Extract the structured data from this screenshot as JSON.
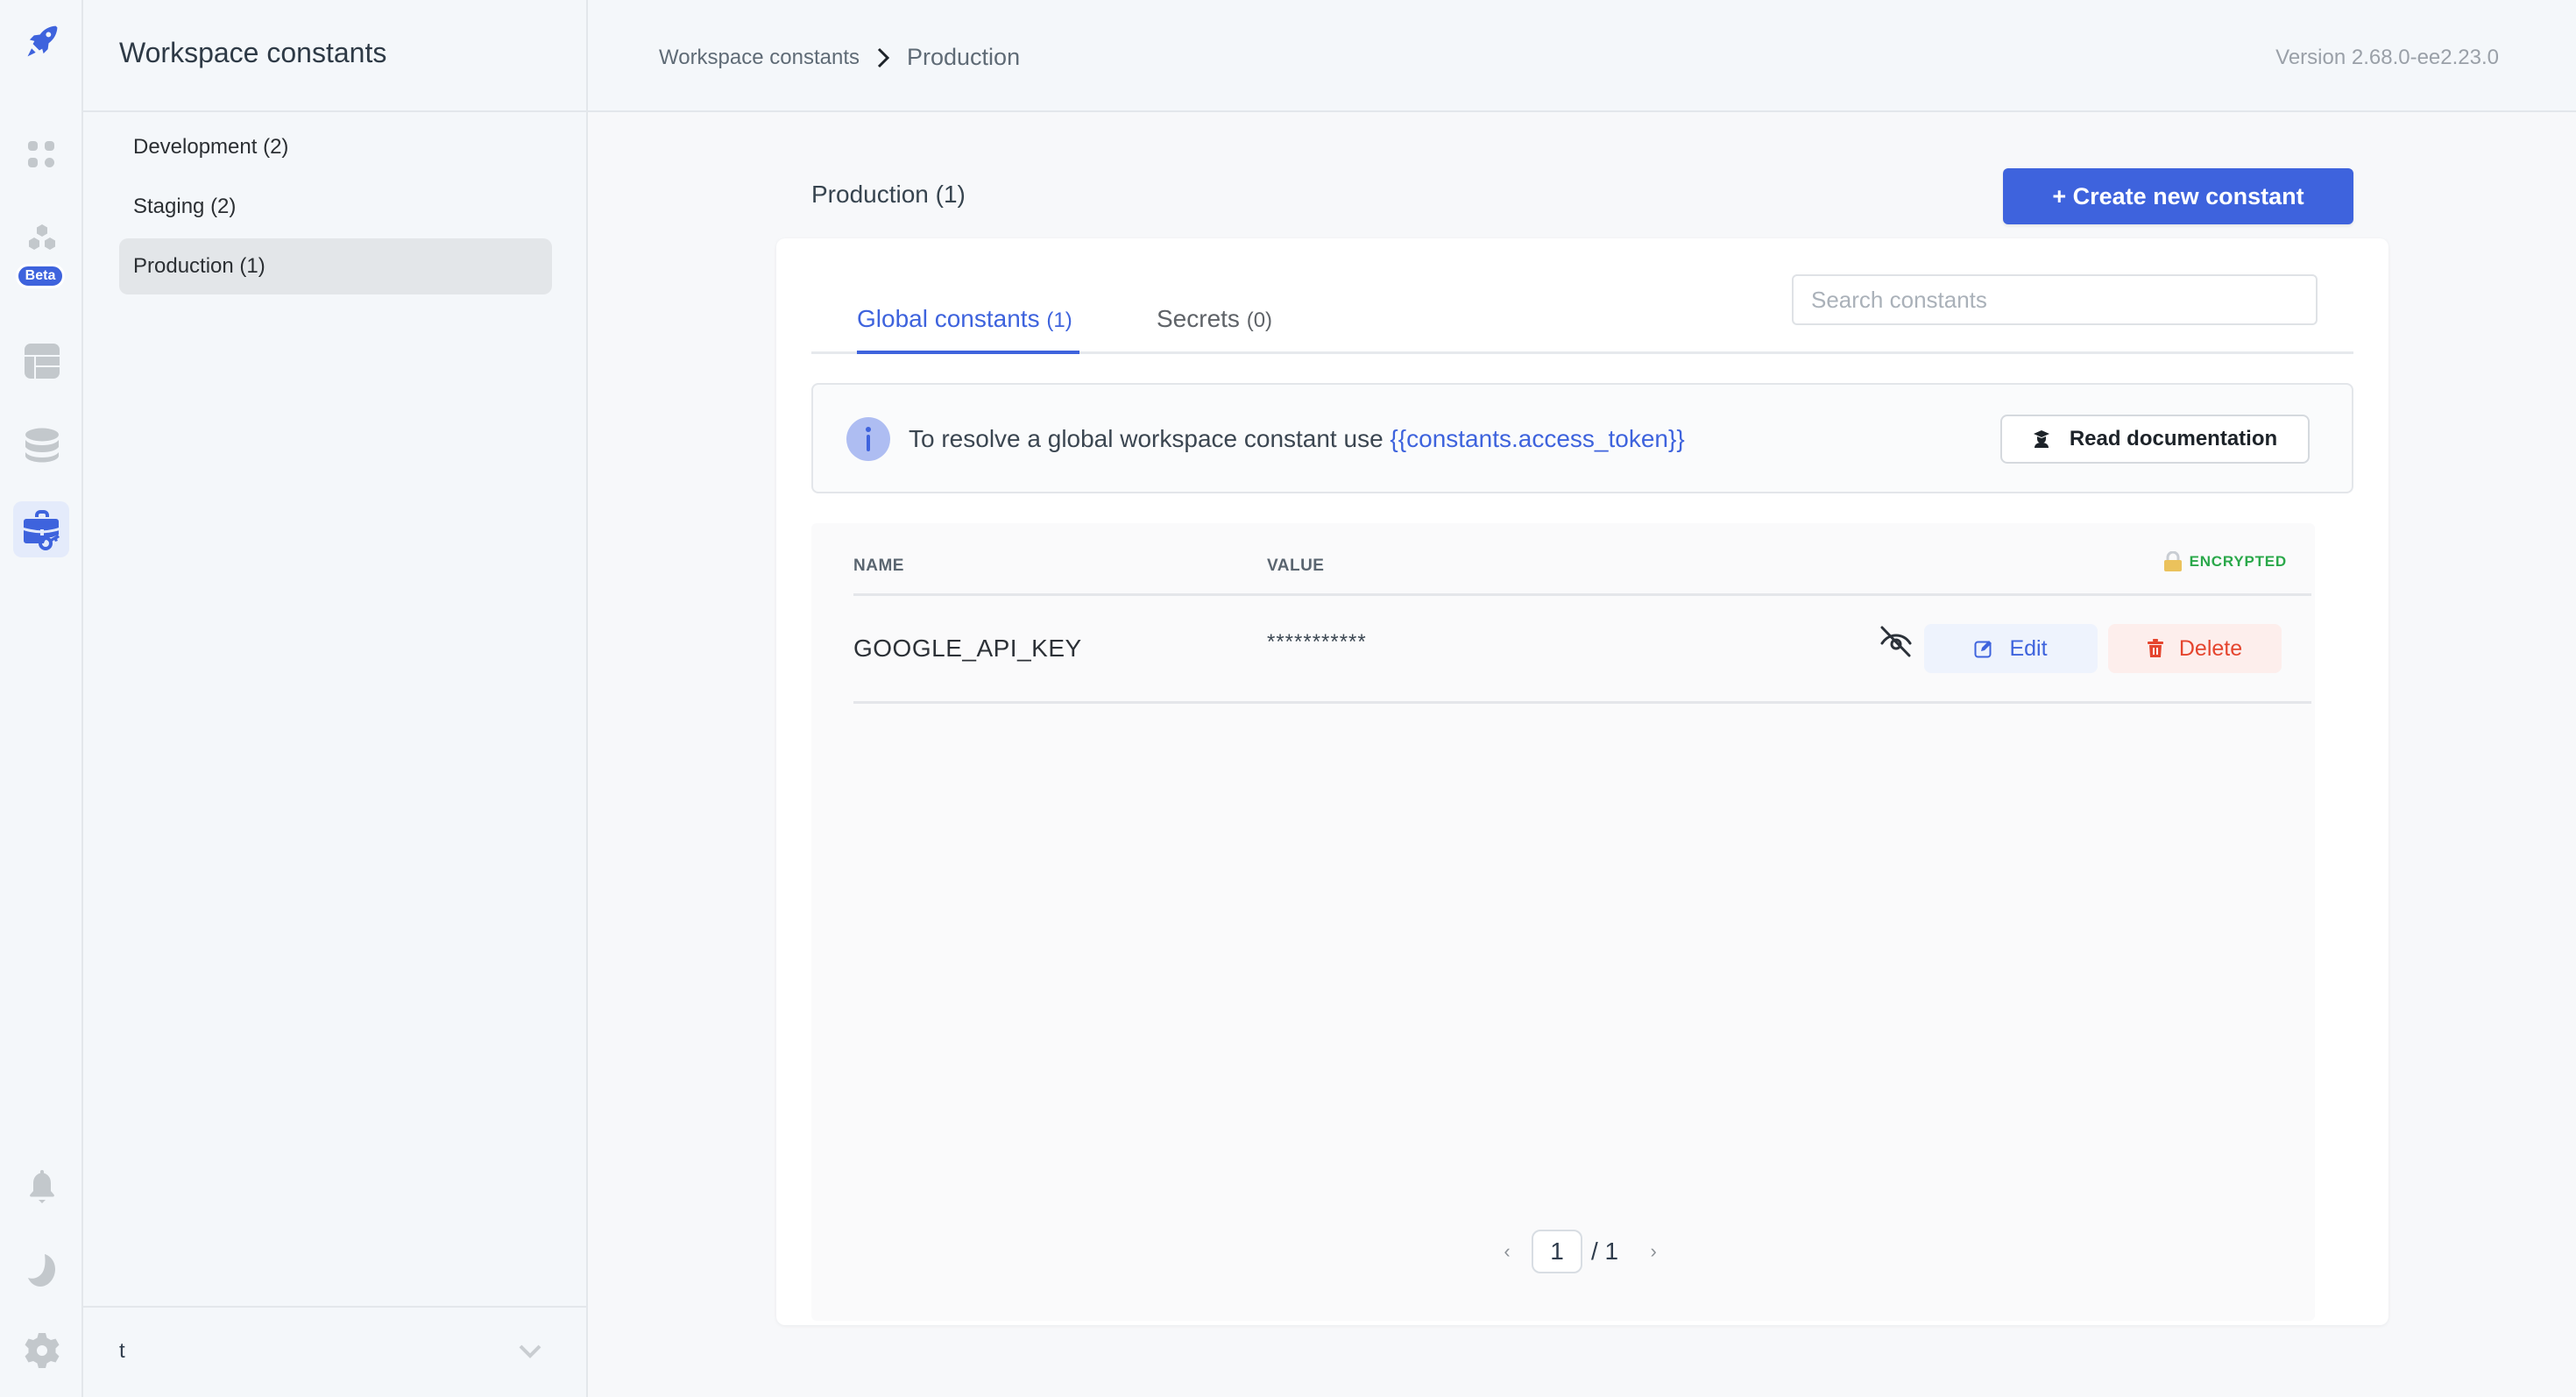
{
  "app": {
    "logo": "rocket-icon",
    "version": "Version 2.68.0-ee2.23.0"
  },
  "rail": {
    "items": [
      {
        "name": "apps",
        "icon": "apps-grid-icon",
        "active": false
      },
      {
        "name": "workflows",
        "icon": "hexagons-icon",
        "badge": "Beta",
        "active": false
      },
      {
        "name": "database",
        "icon": "table-icon",
        "active": false
      },
      {
        "name": "data-sources",
        "icon": "database-icon",
        "active": false
      },
      {
        "name": "workspace-constants",
        "icon": "briefcase-key-icon",
        "active": true
      }
    ],
    "bottom": [
      {
        "name": "notifications",
        "icon": "bell-icon"
      },
      {
        "name": "theme",
        "icon": "moon-icon"
      },
      {
        "name": "settings",
        "icon": "gear-icon"
      }
    ]
  },
  "panel": {
    "title": "Workspace constants",
    "environments": [
      {
        "label": "Development (2)",
        "active": false
      },
      {
        "label": "Staging (2)",
        "active": false
      },
      {
        "label": "Production (1)",
        "active": true
      }
    ],
    "workspace": {
      "label": "t"
    }
  },
  "header": {
    "breadcrumb": {
      "root": "Workspace constants",
      "current": "Production"
    }
  },
  "main": {
    "section_title": "Production (1)",
    "create_button": "+ Create new constant",
    "tabs": [
      {
        "label": "Global constants",
        "count": "(1)",
        "active": true
      },
      {
        "label": "Secrets",
        "count": "(0)",
        "active": false
      }
    ],
    "search": {
      "placeholder": "Search constants",
      "value": ""
    },
    "info": {
      "text": "To resolve a global workspace constant use",
      "code": "{{constants.access_token}}",
      "doc_button": "Read documentation"
    },
    "table": {
      "columns": {
        "name": "NAME",
        "value": "VALUE"
      },
      "encrypted_label": "ENCRYPTED",
      "rows": [
        {
          "name": "GOOGLE_API_KEY",
          "value": "***********",
          "edit": "Edit",
          "delete": "Delete"
        }
      ]
    },
    "pagination": {
      "current": "1",
      "total": "/ 1"
    }
  },
  "colors": {
    "accent": "#3e63dd",
    "encrypted": "#2aa84a",
    "danger": "#e5452e"
  }
}
